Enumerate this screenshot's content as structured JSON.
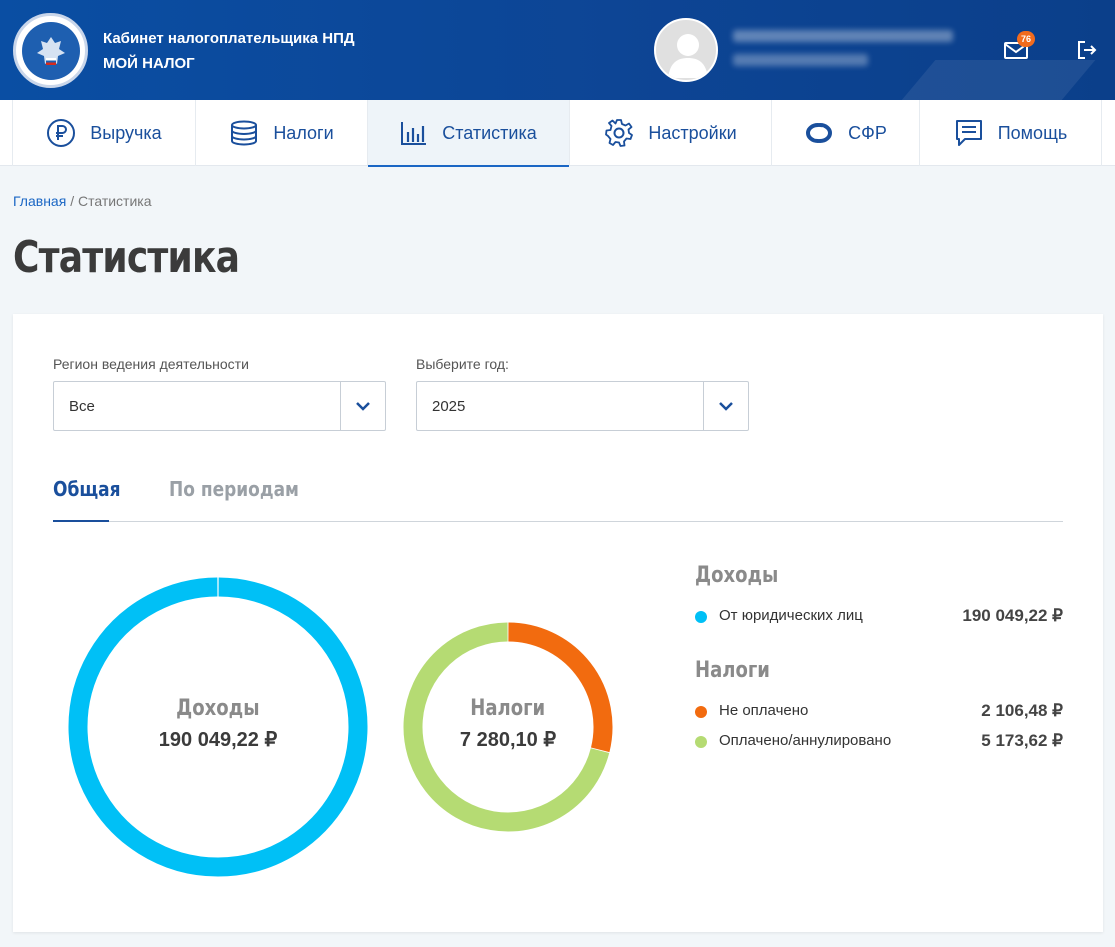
{
  "header": {
    "title_line1": "Кабинет налогоплательщика НПД",
    "title_line2": "МОЙ НАЛОГ",
    "notifications_count": "76",
    "icons": [
      "emblem-icon",
      "user-avatar-icon",
      "mail-icon",
      "logout-icon"
    ]
  },
  "nav": {
    "items": [
      {
        "label": "Выручка",
        "icon": "ruble-icon"
      },
      {
        "label": "Налоги",
        "icon": "coins-icon"
      },
      {
        "label": "Статистика",
        "icon": "bar-chart-icon",
        "active": true
      },
      {
        "label": "Настройки",
        "icon": "gear-icon"
      },
      {
        "label": "СФР",
        "icon": "sfr-logo-icon"
      },
      {
        "label": "Помощь",
        "icon": "chat-icon"
      }
    ]
  },
  "breadcrumb": {
    "home": "Главная",
    "separator": "/",
    "current": "Статистика"
  },
  "page_title": "Статистика",
  "filters": {
    "region_label": "Регион ведения деятельности",
    "region_value": "Все",
    "year_label": "Выберите год:",
    "year_value": "2025"
  },
  "tabs": {
    "general": "Общая",
    "periods": "По периодам"
  },
  "income_donut": {
    "title": "Доходы",
    "total": "190 049,22 ₽"
  },
  "taxes_donut": {
    "title": "Налоги",
    "total": "7 280,10 ₽"
  },
  "legend": {
    "income_heading": "Доходы",
    "income_rows": [
      {
        "label": "От юридических лиц",
        "amount": "190 049,22 ₽",
        "color": "#00c0f6"
      }
    ],
    "taxes_heading": "Налоги",
    "tax_rows": [
      {
        "label": "Не оплачено",
        "amount": "2 106,48 ₽",
        "color": "#f26b0f"
      },
      {
        "label": "Оплачено/аннулировано",
        "amount": "5 173,62 ₽",
        "color": "#b5db73"
      }
    ]
  },
  "chart_data": [
    {
      "type": "pie",
      "title": "Доходы",
      "categories": [
        "От юридических лиц"
      ],
      "values": [
        190049.22
      ],
      "colors": [
        "#00c0f6"
      ]
    },
    {
      "type": "pie",
      "title": "Налоги",
      "categories": [
        "Не оплачено",
        "Оплачено/аннулировано"
      ],
      "values": [
        2106.48,
        5173.62
      ],
      "colors": [
        "#f26b0f",
        "#b5db73"
      ]
    }
  ]
}
